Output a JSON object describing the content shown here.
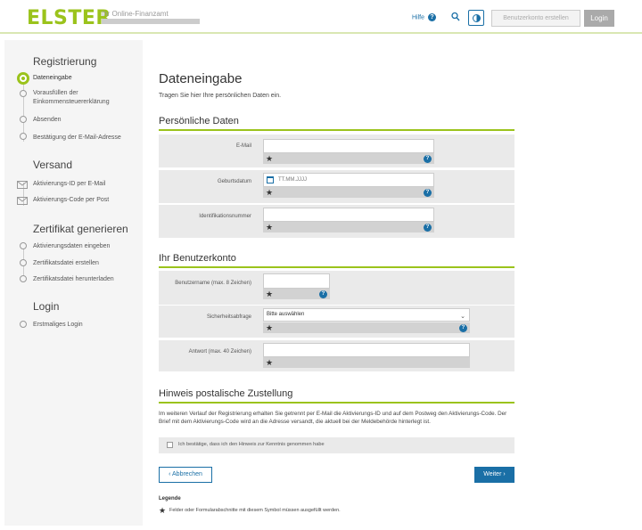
{
  "header": {
    "logo": "ELSTER",
    "tagline": "Ihr Online-Finanzamt",
    "help_label": "Hilfe",
    "create_account_label": "Benutzerkonto erstellen",
    "login_label": "Login"
  },
  "sidebar": {
    "sections": [
      {
        "heading": "Registrierung",
        "items": [
          "Dateneingabe",
          "Vorausfüllen der Einkommensteuererklärung",
          "Absenden",
          "Bestätigung der E-Mail-Adresse"
        ]
      },
      {
        "heading": "Versand",
        "items": [
          "Aktivierungs-ID per E-Mail",
          "Aktivierungs-Code per Post"
        ]
      },
      {
        "heading": "Zertifikat generieren",
        "items": [
          "Aktivierungsdaten eingeben",
          "Zertifikatsdatei erstellen",
          "Zertifikatsdatei herunterladen"
        ]
      },
      {
        "heading": "Login",
        "items": [
          "Erstmaliges Login"
        ]
      }
    ]
  },
  "main": {
    "title": "Dateneingabe",
    "intro": "Tragen Sie hier Ihre persönlichen Daten ein.",
    "personal": {
      "title": "Persönliche Daten",
      "email_label": "E-Mail",
      "birthdate_label": "Geburtsdatum",
      "birthdate_placeholder": "TT.MM.JJJJ",
      "id_label": "Identifikationsnummer"
    },
    "account": {
      "title": "Ihr Benutzerkonto",
      "username_label": "Benutzername (max. 8 Zeichen)",
      "question_label": "Sicherheitsabfrage",
      "question_value": "Bitte auswählen",
      "answer_label": "Antwort (max. 40 Zeichen)"
    },
    "notice": {
      "title": "Hinweis postalische Zustellung",
      "text": "Im weiteren Verlauf der Registrierung erhalten Sie getrennt per E-Mail die Aktivierungs-ID und auf dem Postweg den Aktivierungs-Code. Der Brief mit dem Aktivierungs-Code wird an die Adresse versandt, die aktuell bei der Meldebehörde hinterlegt ist.",
      "confirm_label": "Ich bestätige, dass ich den Hinweis zur Kenntnis genommen habe"
    },
    "back_label": "Abbrechen",
    "next_label": "Weiter",
    "legend_title": "Legende",
    "legend_text": "Felder oder Formularabschnitte mit diesem Symbol müssen ausgefüllt werden."
  },
  "icons": {
    "help": "question-mark-icon",
    "search": "search-icon",
    "contrast": "contrast-icon",
    "required": "star-icon",
    "calendar": "calendar-icon"
  },
  "colors": {
    "brand_green": "#9bc31c",
    "link_blue": "#1a6fa6",
    "row_gray": "#eaeaea"
  }
}
